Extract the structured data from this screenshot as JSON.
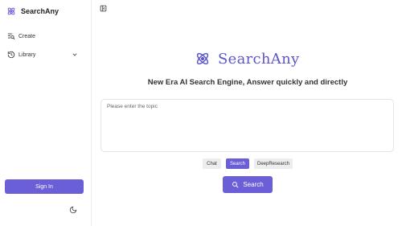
{
  "brand": {
    "name": "SearchAny",
    "accent": "#6b5fd8",
    "logo_icon": "atom-icon"
  },
  "sidebar": {
    "items": [
      {
        "label": "Create",
        "icon": "search-list-icon"
      },
      {
        "label": "Library",
        "icon": "history-icon",
        "expand_icon": "chevron-down-icon"
      }
    ],
    "sign_in_label": "Sign In",
    "theme_icon": "moon-icon"
  },
  "header": {
    "collapse_icon": "sidebar-toggle-icon"
  },
  "main": {
    "logo_text": "SearchAny",
    "tagline": "New Era AI Search Engine, Answer quickly and directly",
    "topic_placeholder": "Please enter the topic",
    "modes": [
      {
        "label": "Chat",
        "selected": false
      },
      {
        "label": "Search",
        "selected": true
      },
      {
        "label": "DeepResearch",
        "selected": false
      }
    ],
    "search_button_label": "Search",
    "search_icon": "search-icon"
  }
}
